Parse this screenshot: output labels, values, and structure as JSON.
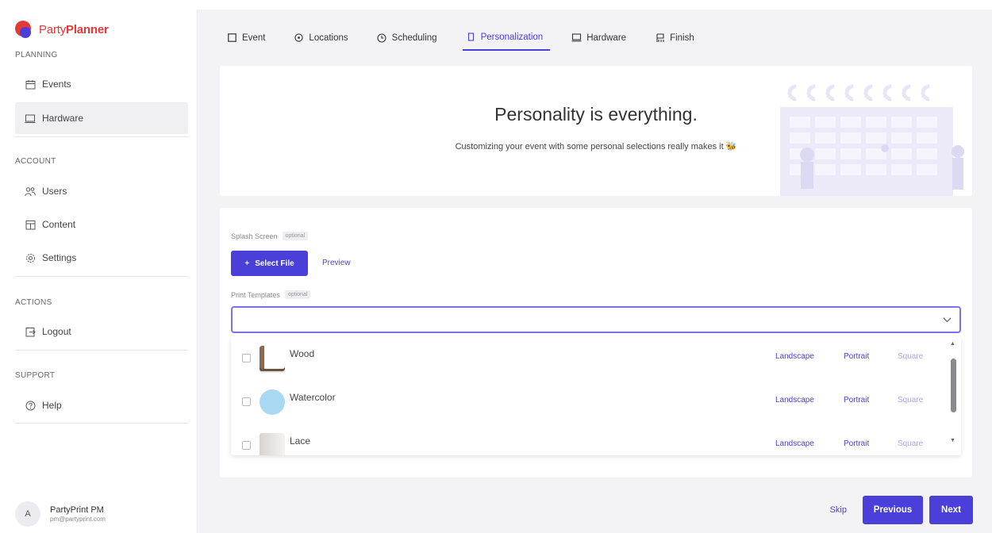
{
  "app": {
    "brand_part1": "Party",
    "brand_part2": "Planner",
    "accent": "#4a3fd8",
    "brand_color": "#e53935"
  },
  "sidebar": {
    "sections": {
      "planning": "PLANNING",
      "account": "ACCOUNT",
      "actions": "ACTIONS",
      "support": "SUPPORT"
    },
    "items": [
      {
        "label": "Events",
        "icon": "calendar-icon"
      },
      {
        "label": "Hardware",
        "icon": "laptop-icon",
        "active": true
      },
      {
        "label": "Users",
        "icon": "users-icon"
      },
      {
        "label": "Content",
        "icon": "content-icon"
      },
      {
        "label": "Settings",
        "icon": "gear-icon"
      },
      {
        "label": "Logout",
        "icon": "logout-icon"
      },
      {
        "label": "Help",
        "icon": "help-icon"
      }
    ],
    "user": {
      "initial": "A",
      "name": "PartyPrint PM",
      "email": "pm@partyprint.com"
    }
  },
  "tabs": [
    {
      "label": "Event",
      "icon": "square-icon"
    },
    {
      "label": "Locations",
      "icon": "pin-icon"
    },
    {
      "label": "Scheduling",
      "icon": "clock-icon"
    },
    {
      "label": "Personalization",
      "icon": "square-icon",
      "active": true
    },
    {
      "label": "Hardware",
      "icon": "laptop-icon"
    },
    {
      "label": "Finish",
      "icon": "flag-icon"
    }
  ],
  "hero": {
    "title": "Personality is everything.",
    "subtitle": "Customizing your event with some personal selections really makes it 🐝"
  },
  "form": {
    "splash_label": "Splash Screen",
    "optional": "optional",
    "select_file": "Select File",
    "preview": "Preview",
    "templates_label": "Print Templates",
    "templates_value": ""
  },
  "templates": [
    {
      "name": "Wood",
      "landscape": "Landscape",
      "portrait": "Portrait",
      "square": "Square"
    },
    {
      "name": "Watercolor",
      "landscape": "Landscape",
      "portrait": "Portrait",
      "square": "Square"
    },
    {
      "name": "Lace",
      "landscape": "Landscape",
      "portrait": "Portrait",
      "square": "Square"
    }
  ],
  "footer": {
    "skip": "Skip",
    "previous": "Previous",
    "next": "Next"
  }
}
